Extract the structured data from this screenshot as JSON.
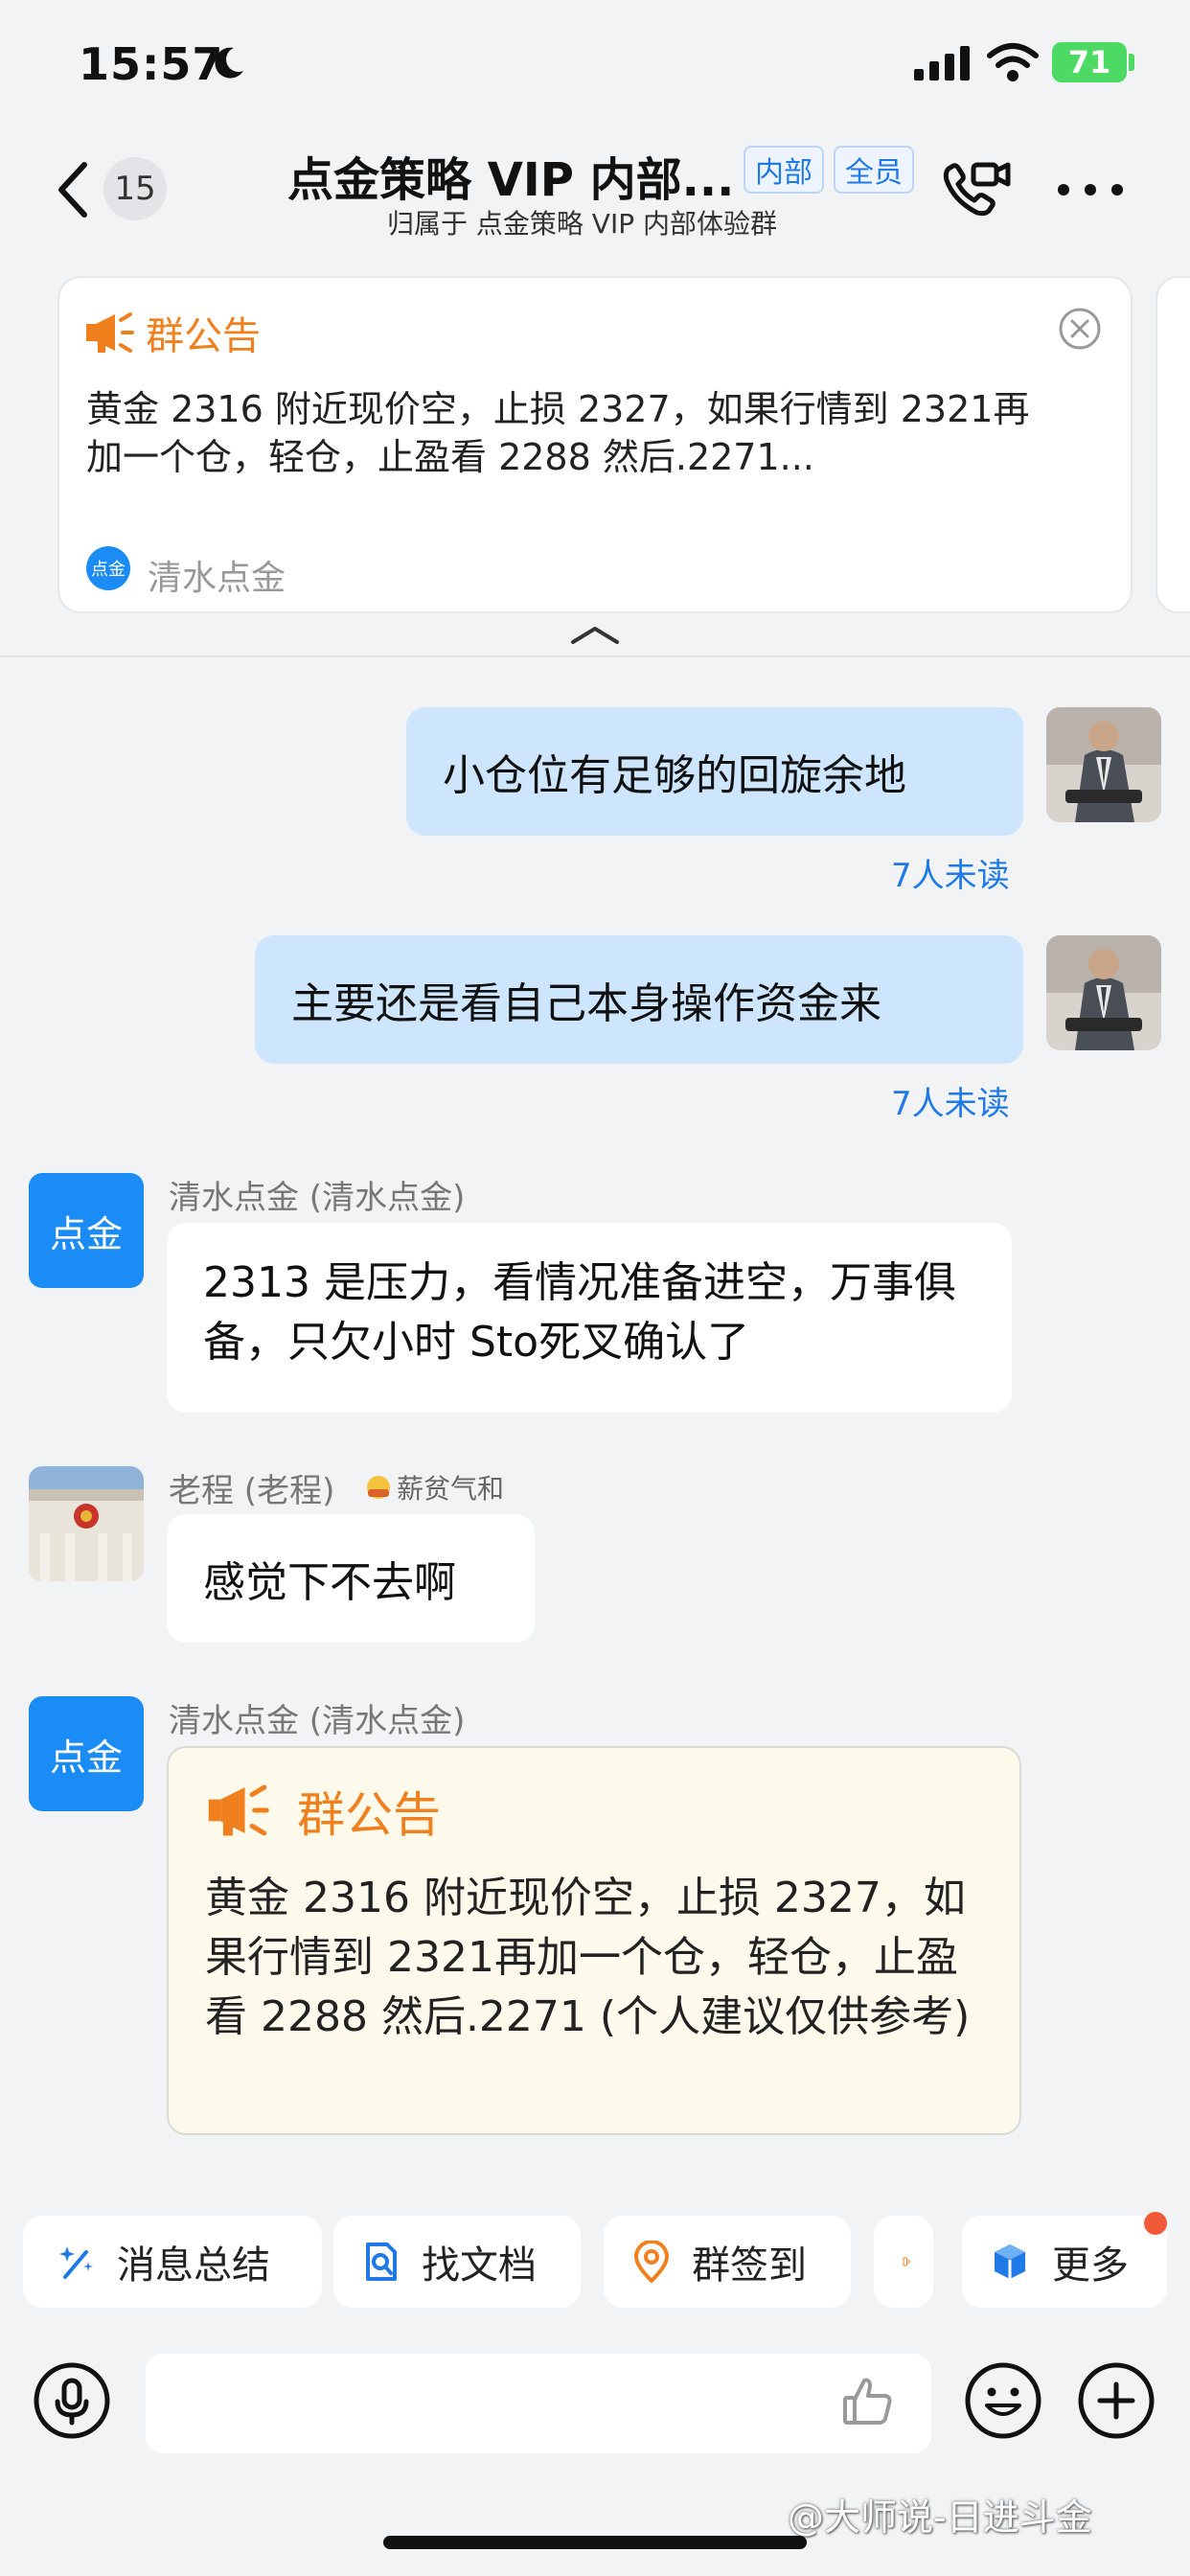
{
  "status_bar": {
    "time": "15:57",
    "battery": "71"
  },
  "header": {
    "unread_count": "15",
    "title": "点金策略 VIP 内部...",
    "tags": [
      "内部",
      "全员"
    ],
    "subtitle": "归属于 点金策略 VIP 内部体验群"
  },
  "notice_card": {
    "title": "群公告",
    "text": "黄金 2316 附近现价空，止损 2327，如果行情到 2321再加一个仓，轻仓，止盈看 2288 然后.2271...",
    "author_badge": "点金",
    "author_name": "清水点金"
  },
  "messages": [
    {
      "side": "right",
      "text": "小仓位有足够的回旋余地",
      "status": "7人未读"
    },
    {
      "side": "right",
      "text": "主要还是看自己本身操作资金来",
      "status": "7人未读"
    },
    {
      "side": "left",
      "sender": "清水点金 (清水点金)",
      "avatar_text": "点金",
      "text": "2313 是压力，看情况准备进空，万事俱备，只欠小时 Sto死叉确认了"
    },
    {
      "side": "left",
      "sender": "老程 (老程)",
      "badge": "薪贫气和",
      "text": "感觉下不去啊"
    },
    {
      "side": "left",
      "sender": "清水点金 (清水点金)",
      "avatar_text": "点金",
      "notice_title": "群公告",
      "notice_text": "黄金 2316 附近现价空，止损 2327，如果行情到 2321再加一个仓，轻仓，止盈看 2288 然后.2271 (个人建议仅供参考)"
    }
  ],
  "quick_actions": [
    {
      "label": "消息总结",
      "icon": "sparkle-pen-icon"
    },
    {
      "label": "找文档",
      "icon": "doc-search-icon"
    },
    {
      "label": "群签到",
      "icon": "location-pin-icon"
    },
    {
      "label": "",
      "icon": "partial-icon"
    },
    {
      "label": "更多",
      "icon": "cube-icon"
    }
  ],
  "input": {
    "placeholder": ""
  },
  "watermark": "@大师说-日进斗金",
  "colors": {
    "accent": "#1f7ae8",
    "bubble_me": "#cde6fd",
    "notice_orange": "#f07f1e",
    "badge_blue": "#1b8cf5"
  }
}
